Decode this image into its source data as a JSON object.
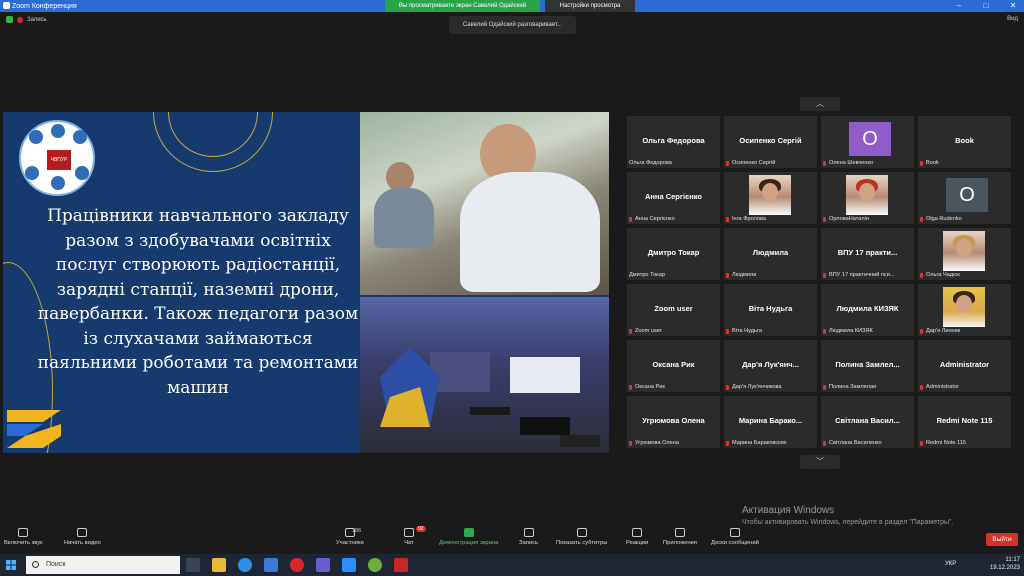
{
  "window": {
    "title": "Zoom Конференция",
    "share_banner": "Вы просматриваете экран Савелий Одайский",
    "view_settings": "Настройки просмотра",
    "minimize": "–",
    "maximize": "□",
    "close": "✕"
  },
  "status": {
    "recording_label": "Запись",
    "speaking": "Савелий Одайский разговаривает...",
    "view_label": "Вид"
  },
  "slide": {
    "logo_text": "ЧВПУР",
    "text": "Працівники навчального закладу разом з здобувачами освітніх послуг створюють радіостанції, зарядні станції, наземні дрони, павербанки. Також педагоги разом із слухачами займаються паяльними роботами та ремонтами машин"
  },
  "gallery": {
    "tiles": [
      {
        "big": "Ольга Федорова",
        "small": "Ольга Федорова",
        "muted": false,
        "type": "name"
      },
      {
        "big": "Осипенко Сергій",
        "small": "Осипенко Сергій",
        "muted": true,
        "type": "name"
      },
      {
        "initial": "О",
        "small": "Олена Шевченко",
        "muted": true,
        "type": "initial",
        "color": "#8f5dc9"
      },
      {
        "big": "Book",
        "small": "Book",
        "muted": true,
        "type": "name"
      },
      {
        "big": "Анна Сергієнко",
        "small": "Анна Сергієнко",
        "muted": true,
        "type": "name"
      },
      {
        "small": "Інга Фролова",
        "muted": true,
        "type": "photo",
        "variant": ""
      },
      {
        "small": "ОрловаНаталія",
        "muted": true,
        "type": "photo",
        "variant": "red-hair"
      },
      {
        "initial": "O",
        "small": "Olga Rudenko",
        "muted": true,
        "type": "initial",
        "color": "#4a5560"
      },
      {
        "big": "Дмитро Токар",
        "small": "Дмитро Токар",
        "muted": false,
        "type": "name"
      },
      {
        "big": "Людмила",
        "small": "Людмила",
        "muted": true,
        "type": "name"
      },
      {
        "big": "ВПУ 17 практи...",
        "small": "ВПУ 17 практичний пси...",
        "muted": true,
        "type": "name"
      },
      {
        "small": "Ольга Чадюк",
        "muted": true,
        "type": "photo",
        "variant": "blonde"
      },
      {
        "big": "Zoom user",
        "small": "Zoom user",
        "muted": true,
        "type": "name"
      },
      {
        "big": "Віта Нудьга",
        "small": "Віта Нудьга",
        "muted": true,
        "type": "name"
      },
      {
        "big": "Людмила КИЗЯК",
        "small": "Людмила КИЗЯК",
        "muted": true,
        "type": "name"
      },
      {
        "small": "Дар'я Линник",
        "muted": true,
        "type": "photo",
        "variant": "yellow-bg"
      },
      {
        "big": "Оксана Рик",
        "small": "Оксана Рик",
        "muted": true,
        "type": "name"
      },
      {
        "big": "Дар'я Лук'янч...",
        "small": "Дар'я Лук'янчикова",
        "muted": true,
        "type": "name"
      },
      {
        "big": "Полина Замлел...",
        "small": "Полина Замлелая",
        "muted": true,
        "type": "name"
      },
      {
        "big": "Administrator",
        "small": "Administrator",
        "muted": true,
        "type": "name"
      },
      {
        "big": "Угрюмова Олена",
        "small": "Угрюмова Олена",
        "muted": true,
        "type": "name"
      },
      {
        "big": "Марина Барако...",
        "small": "Марина Бараковских",
        "muted": true,
        "type": "name"
      },
      {
        "big": "Світлана Васил...",
        "small": "Світлана Василенко",
        "muted": true,
        "type": "name"
      },
      {
        "big": "Redmi Note 115",
        "small": "Redmi Note 115",
        "muted": true,
        "type": "name"
      }
    ]
  },
  "watermark": {
    "title": "Активация Windows",
    "subtitle": "Чтобы активировать Windows, перейдите в раздел \"Параметры\"."
  },
  "toolbar": {
    "unmute": "Включить звук",
    "start_video": "Начать видео",
    "participants": "Участники",
    "participants_count": "186",
    "chat": "Чат",
    "chat_badge": "92",
    "share": "Демонстрация экрана",
    "record": "Запись",
    "captions": "Показать субтитры",
    "reactions": "Реакции",
    "apps": "Приложения",
    "whiteboards": "Доски сообщений",
    "leave": "Выйти"
  },
  "taskbar": {
    "search_placeholder": "Поиск",
    "lang": "УКР",
    "time": "11:17",
    "date": "19.12.2023"
  }
}
